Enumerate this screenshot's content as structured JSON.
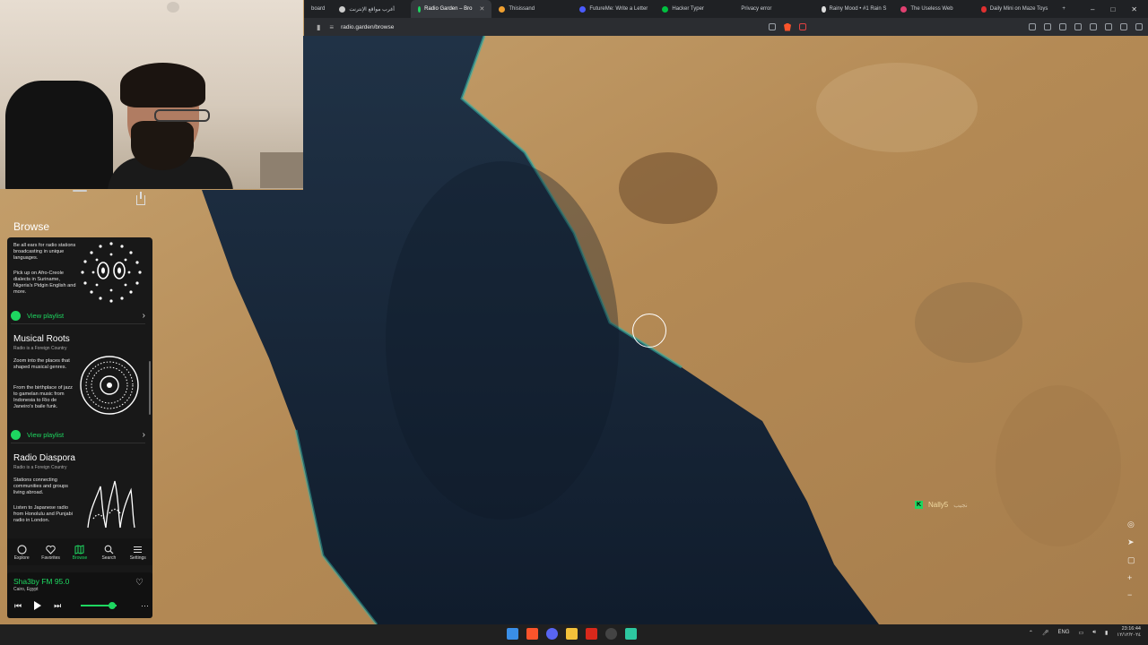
{
  "browser": {
    "tabs": [
      {
        "label": "board",
        "color": "#777777",
        "active": false
      },
      {
        "label": "أغرب مواقع الإنترنت",
        "color": "#cccccc",
        "active": false
      },
      {
        "label": "Radio Garden – Bro",
        "color": "#1ed760",
        "active": true
      },
      {
        "label": "Thisissand",
        "color": "#f0a030",
        "active": false
      },
      {
        "label": "FutureMe: Write a Letter",
        "color": "#4a5bff",
        "active": false
      },
      {
        "label": "Hacker Typer",
        "color": "#00c040",
        "active": false
      },
      {
        "label": "Privacy error",
        "color": "#888888",
        "active": false
      },
      {
        "label": "Rainy Mood • #1 Rain S",
        "color": "#dddddd",
        "active": false
      },
      {
        "label": "The Useless Web",
        "color": "#e04070",
        "active": false
      },
      {
        "label": "Daily Mini on Maze Toys",
        "color": "#e03030",
        "active": false
      }
    ],
    "url": "radio.garden/browse"
  },
  "sidebar": {
    "title": "Browse",
    "cards": [
      {
        "text1": "Be all ears for radio stations broadcasting in unique languages.",
        "text2": "Pick up on Afro-Creole dialects in Suriname, Nigeria's Pidgin English and more.",
        "playlist_label": "View playlist"
      },
      {
        "title": "Musical Roots",
        "subtitle": "Radio is a Foreign Country",
        "text1": "Zoom into the places that shaped musical genres.",
        "text2": "From the birthplace of jazz to gamelan music from Indonesia to Rio de Janeiro's baile funk.",
        "playlist_label": "View playlist"
      },
      {
        "title": "Radio Diaspora",
        "subtitle": "Radio is a Foreign Country",
        "text1": "Stations connecting communities and groups living abroad.",
        "text2": "Listen to Japanese radio from Honolulu and Punjabi radio in London."
      }
    ],
    "nav": [
      {
        "label": "Explore",
        "icon": "circle-icon"
      },
      {
        "label": "Favorites",
        "icon": "heart-icon"
      },
      {
        "label": "Browse",
        "icon": "map-icon",
        "active": true
      },
      {
        "label": "Search",
        "icon": "search-icon"
      },
      {
        "label": "Settings",
        "icon": "menu-icon"
      }
    ]
  },
  "player": {
    "station": "Sha3by FM 95.0",
    "location": "Cairo, Egypt",
    "volume_fraction": 0.88
  },
  "map": {
    "marker_label": "Nally5",
    "marker_arabic": "نجيب"
  },
  "taskbar": {
    "lang": "ENG",
    "time": "23:16:44",
    "date": "١٢/١٢/٢٠٢٤"
  },
  "colors": {
    "accent": "#1ed760",
    "sea": "#16253a",
    "land": "#b8935e"
  }
}
